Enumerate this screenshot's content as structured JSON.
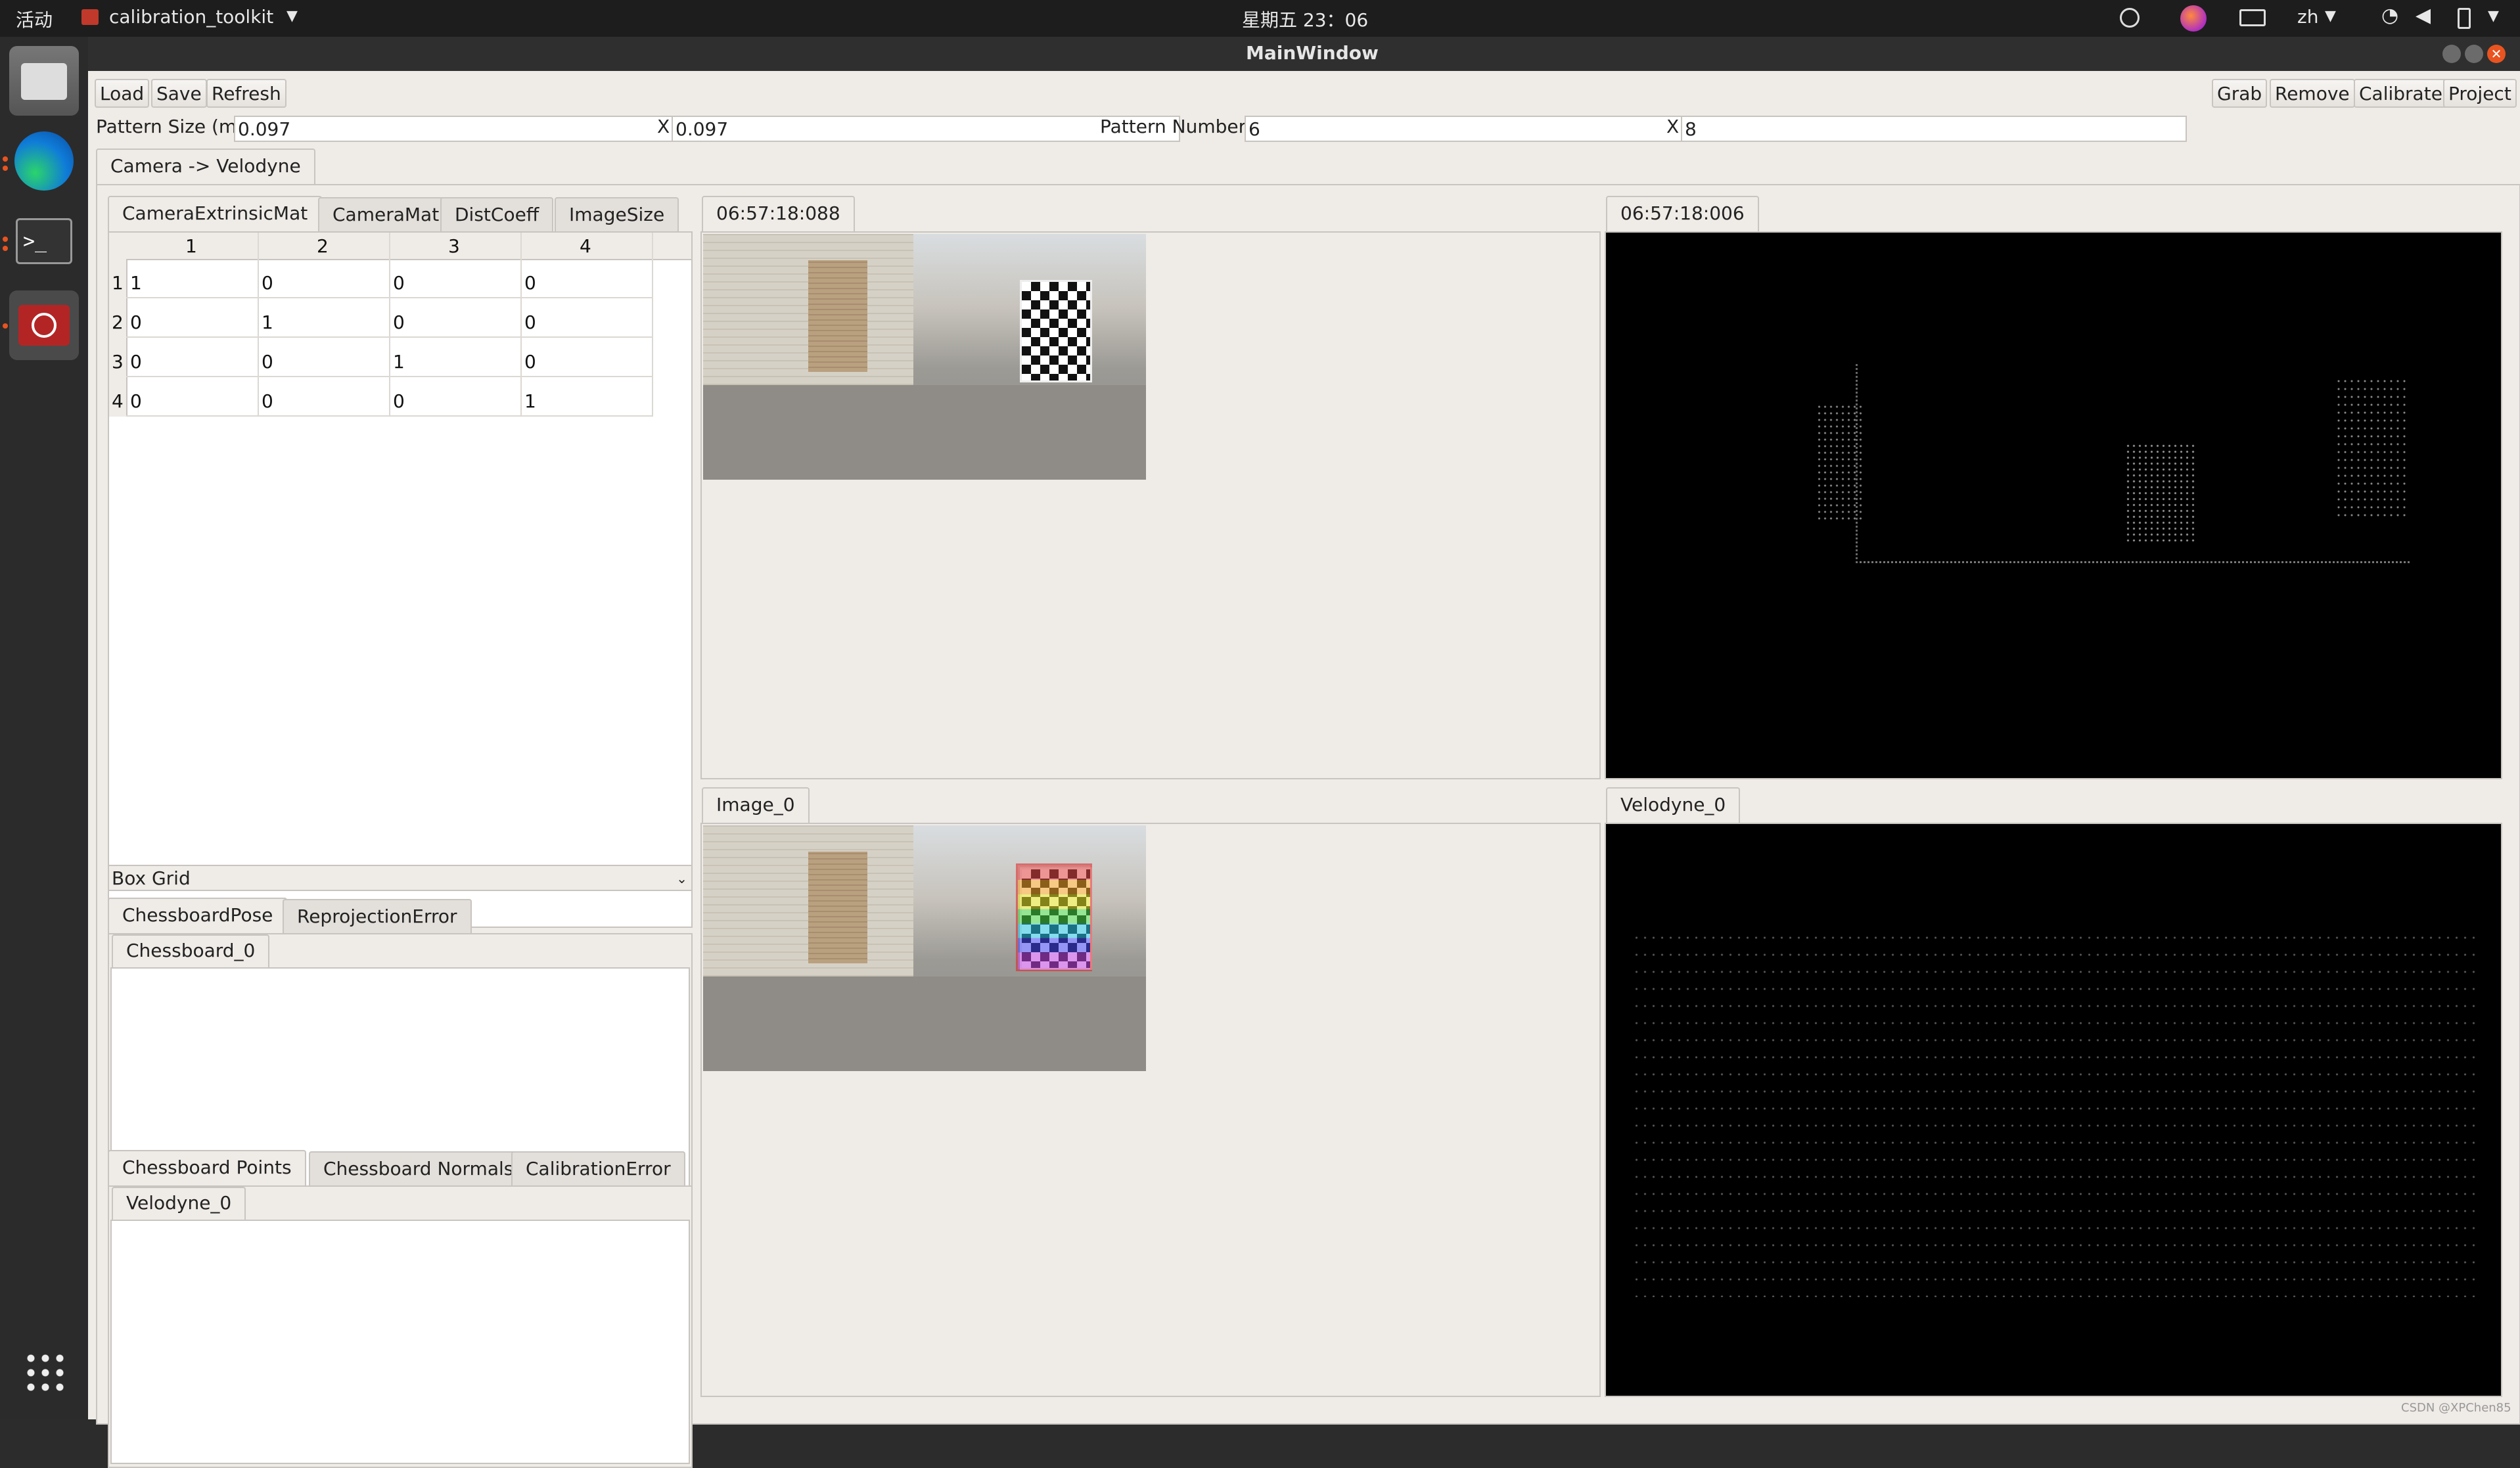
{
  "topbar": {
    "activities": "活动",
    "app_menu": "calibration_toolkit",
    "clock": "星期五 23：06",
    "lang": "zh"
  },
  "window": {
    "title": "MainWindow"
  },
  "toolbar_left": {
    "load": "Load",
    "save": "Save",
    "refresh": "Refresh"
  },
  "toolbar_right": {
    "grab": "Grab",
    "remove": "Remove",
    "calibrate": "Calibrate",
    "project": "Project"
  },
  "pattern": {
    "size_label": "Pattern Size (m)",
    "size_x_value": "0.097",
    "x_label": "X",
    "size_y_value": "0.097",
    "number_label": "Pattern Number",
    "number_x_value": "6",
    "x2_label": "X",
    "number_y_value": "8"
  },
  "main_tab": "Camera -> Velodyne",
  "matrix_tabs": [
    "CameraExtrinsicMat",
    "CameraMat",
    "DistCoeff",
    "ImageSize"
  ],
  "matrix": {
    "col_headers": [
      "1",
      "2",
      "3",
      "4"
    ],
    "row_headers": [
      "1",
      "2",
      "3",
      "4"
    ],
    "rows": [
      [
        "1",
        "0",
        "0",
        "0"
      ],
      [
        "0",
        "1",
        "0",
        "0"
      ],
      [
        "0",
        "0",
        "1",
        "0"
      ],
      [
        "0",
        "0",
        "0",
        "1"
      ]
    ]
  },
  "box_grid": "Box Grid",
  "pose_tabs": [
    "ChessboardPose",
    "ReprojectionError"
  ],
  "pose_subtab": "Chessboard_0",
  "points_tabs": [
    "Chessboard Points",
    "Chessboard Normals",
    "CalibrationError"
  ],
  "points_subtab": "Velodyne_0",
  "views": {
    "camera_live_tab": "06:57:18:088",
    "lidar_live_tab": "06:57:18:006",
    "camera_capture_tab": "Image_0",
    "lidar_capture_tab": "Velodyne_0"
  },
  "watermark": "CSDN @XPChen85",
  "colors": {
    "accent": "#e95420",
    "lidar_bg": "#000000"
  }
}
